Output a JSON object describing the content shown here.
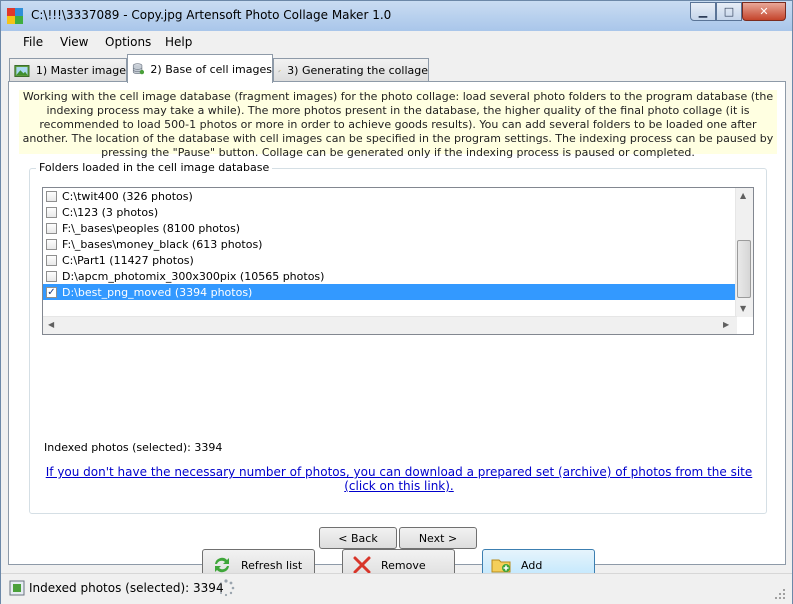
{
  "window": {
    "title": "C:\\!!!\\3337089 - Copy.jpg Artensoft Photo Collage Maker 1.0"
  },
  "menu": [
    "File",
    "View",
    "Options",
    "Help"
  ],
  "tabs": [
    {
      "label": "1) Master image"
    },
    {
      "label": "2) Base of cell images"
    },
    {
      "label": "3) Generating the collage"
    }
  ],
  "info_text": "Working with the cell image database (fragment images) for the photo collage: load several photo folders to the program database (the indexing process may take a while). The more photos present in the database, the higher quality of the final photo collage (it is recommended to load 500-1 photos or more in order to achieve goods results). You can add several folders to be loaded one after another. The location of the database with cell images can be specified in the program settings. The indexing process can be paused by pressing the \"Pause\" button. Collage can be generated only if the indexing process is paused or completed.",
  "group_label": "Folders loaded in the cell image database",
  "folders": [
    {
      "label": "C:\\twit400 (326 photos)",
      "checked": false,
      "selected": false
    },
    {
      "label": "C:\\123 (3 photos)",
      "checked": false,
      "selected": false
    },
    {
      "label": "F:\\_bases\\peoples (8100 photos)",
      "checked": false,
      "selected": false
    },
    {
      "label": "F:\\_bases\\money_black (613 photos)",
      "checked": false,
      "selected": false
    },
    {
      "label": "C:\\Part1 (11427 photos)",
      "checked": false,
      "selected": false
    },
    {
      "label": "D:\\apcm_photomix_300x300pix (10565 photos)",
      "checked": false,
      "selected": false
    },
    {
      "label": "D:\\best_png_moved (3394 photos)",
      "checked": true,
      "selected": true
    }
  ],
  "indexed_label": "Indexed photos (selected): 3394",
  "download_link": "If you don't have the necessary number of photos, you can download a prepared set (archive) of photos from the site (click on this link).",
  "buttons": {
    "refresh": "Refresh list",
    "remove": "Remove",
    "add": "Add"
  },
  "nav": {
    "back": "< Back",
    "next": "Next >"
  },
  "status": {
    "text": "Indexed photos (selected): 3394"
  },
  "colors": {
    "selection": "#3399ff",
    "link": "#0000cc",
    "info_bg": "#ffffe1"
  }
}
